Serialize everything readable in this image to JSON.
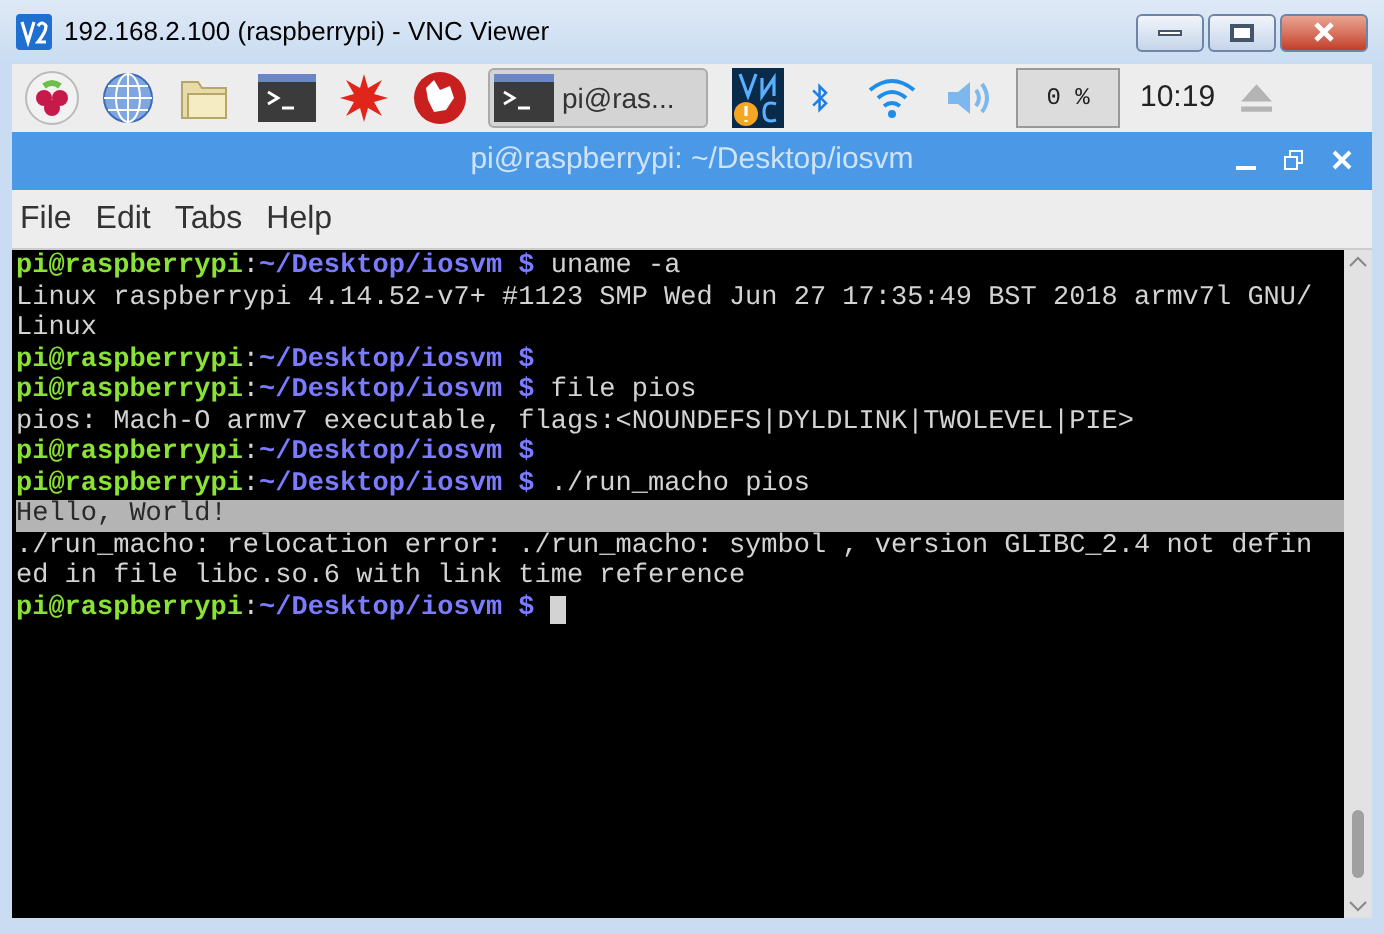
{
  "window": {
    "title": "192.168.2.100 (raspberrypi) - VNC Viewer"
  },
  "taskbar": {
    "tasks": [
      {
        "label": "pi@ras...",
        "selected": true
      }
    ],
    "cpu": "0 %",
    "clock": "10:19"
  },
  "terminal": {
    "title": "pi@raspberrypi: ~/Desktop/iosvm",
    "menu": [
      "File",
      "Edit",
      "Tabs",
      "Help"
    ],
    "lines": [
      {
        "kind": "prompt",
        "user": "pi@raspberrypi",
        "sep": ":",
        "path": "~/Desktop/iosvm $",
        "command": " uname -a"
      },
      {
        "kind": "output",
        "text": "Linux raspberrypi 4.14.52-v7+ #1123 SMP Wed Jun 27 17:35:49 BST 2018 armv7l GNU/"
      },
      {
        "kind": "output",
        "text": "Linux"
      },
      {
        "kind": "prompt",
        "user": "pi@raspberrypi",
        "sep": ":",
        "path": "~/Desktop/iosvm $"
      },
      {
        "kind": "prompt",
        "user": "pi@raspberrypi",
        "sep": ":",
        "path": "~/Desktop/iosvm $",
        "command": " file pios"
      },
      {
        "kind": "output",
        "text": "pios: Mach-O armv7 executable, flags:<NOUNDEFS|DYLDLINK|TWOLEVEL|PIE>"
      },
      {
        "kind": "prompt",
        "user": "pi@raspberrypi",
        "sep": ":",
        "path": "~/Desktop/iosvm $"
      },
      {
        "kind": "prompt",
        "user": "pi@raspberrypi",
        "sep": ":",
        "path": "~/Desktop/iosvm $",
        "command": " ./run_macho pios"
      },
      {
        "kind": "highlight",
        "text": "Hello, World!"
      },
      {
        "kind": "output",
        "text": "./run_macho: relocation error: ./run_macho: symbol , version GLIBC_2.4 not defin"
      },
      {
        "kind": "output",
        "text": "ed in file libc.so.6 with link time reference"
      },
      {
        "kind": "prompt",
        "user": "pi@raspberrypi",
        "sep": ":",
        "path": "~/Desktop/iosvm $",
        "cursor": true
      }
    ]
  }
}
